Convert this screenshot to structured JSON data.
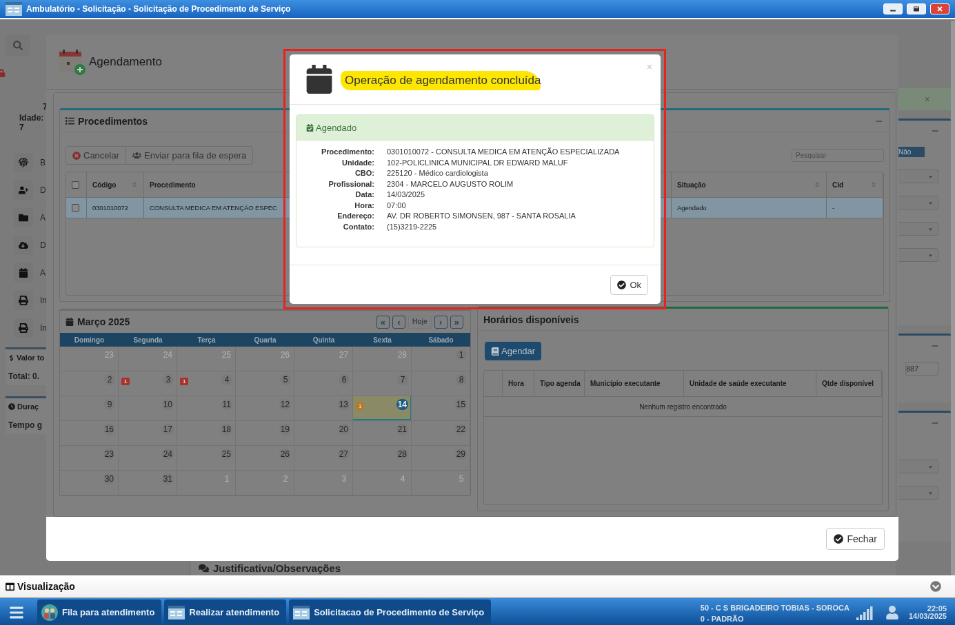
{
  "window": {
    "title": "Ambulatório - Solicitação - Solicitação de Procedimento de Serviço"
  },
  "background": {
    "left": {
      "age_fragment": "7",
      "age_label": "Idade: 7",
      "menu": [
        {
          "kind": "fingerprint",
          "label": "B"
        },
        {
          "kind": "user-plus",
          "label": "D"
        },
        {
          "kind": "folder",
          "label": "A"
        },
        {
          "kind": "download",
          "label": "D"
        },
        {
          "kind": "calendar",
          "label": "A"
        },
        {
          "kind": "print",
          "label": "In"
        },
        {
          "kind": "print",
          "label": "In"
        }
      ],
      "valor": {
        "title": "Valor to",
        "total": "Total: 0."
      },
      "duracao": {
        "title": "Duraç",
        "tempo": "Tempo g"
      }
    },
    "right": {
      "alert_close": "×",
      "toggle": {
        "label": "Não",
        "selected": true
      },
      "field_value": "887"
    },
    "justificativa": "Justificativa/Observações"
  },
  "modal": {
    "title": "Agendamento",
    "procedimentos": {
      "title": "Procedimentos",
      "actions": [
        {
          "kind": "cancel",
          "label": "Cancelar"
        },
        {
          "kind": "queue",
          "label": "Enviar para fila de espera"
        }
      ],
      "search_placeholder": "Pesquisar",
      "select_all_checked": false,
      "columns": [
        {
          "label": "Código",
          "sortable": true
        },
        {
          "label": "Procedimento",
          "sortable": false
        },
        {
          "label": "Situação",
          "sortable": true
        },
        {
          "label": "Cid",
          "sortable": true
        }
      ],
      "rows": [
        {
          "selected": true,
          "checked": false,
          "cells": [
            "0301010072",
            "CONSULTA MEDICA EM ATENÇÃO ESPEC",
            "Agendado",
            "-"
          ]
        }
      ]
    },
    "calendar": {
      "title": "Março 2025",
      "nav": [
        {
          "label": "«",
          "disabled": false
        },
        {
          "label": "‹",
          "disabled": false
        },
        {
          "label": "Hoje",
          "disabled": true
        },
        {
          "label": "›",
          "disabled": false
        },
        {
          "label": "»",
          "disabled": false
        }
      ],
      "weekdays": [
        "Domingo",
        "Segunda",
        "Terça",
        "Quarta",
        "Quinta",
        "Sexta",
        "Sábado"
      ],
      "weeks": [
        [
          {
            "day": "23",
            "other_month": true,
            "today": false
          },
          {
            "day": "24",
            "other_month": true,
            "today": false
          },
          {
            "day": "25",
            "other_month": true,
            "today": false
          },
          {
            "day": "26",
            "other_month": true,
            "today": false
          },
          {
            "day": "27",
            "other_month": true,
            "today": false
          },
          {
            "day": "28",
            "other_month": true,
            "today": false
          },
          {
            "day": "1",
            "other_month": false,
            "today": false
          }
        ],
        [
          {
            "day": "2",
            "other_month": false,
            "today": false
          },
          {
            "day": "3",
            "other_month": false,
            "today": false,
            "badge": {
              "text": "1",
              "color": "#a8322f"
            }
          },
          {
            "day": "4",
            "other_month": false,
            "today": false,
            "badge": {
              "text": "1",
              "color": "#a8322f"
            }
          },
          {
            "day": "5",
            "other_month": false,
            "today": false
          },
          {
            "day": "6",
            "other_month": false,
            "today": false
          },
          {
            "day": "7",
            "other_month": false,
            "today": false
          },
          {
            "day": "8",
            "other_month": false,
            "today": false
          }
        ],
        [
          {
            "day": "9",
            "other_month": false,
            "today": false
          },
          {
            "day": "10",
            "other_month": false,
            "today": false
          },
          {
            "day": "11",
            "other_month": false,
            "today": false
          },
          {
            "day": "12",
            "other_month": false,
            "today": false
          },
          {
            "day": "13",
            "other_month": false,
            "today": false
          },
          {
            "day": "14",
            "other_month": false,
            "today": true,
            "badge": {
              "text": "1",
              "color": "#b57a2c"
            }
          },
          {
            "day": "15",
            "other_month": false,
            "today": false
          }
        ],
        [
          {
            "day": "16",
            "other_month": false,
            "today": false
          },
          {
            "day": "17",
            "other_month": false,
            "today": false
          },
          {
            "day": "18",
            "other_month": false,
            "today": false
          },
          {
            "day": "19",
            "other_month": false,
            "today": false
          },
          {
            "day": "20",
            "other_month": false,
            "today": false
          },
          {
            "day": "21",
            "other_month": false,
            "today": false
          },
          {
            "day": "22",
            "other_month": false,
            "today": false
          }
        ],
        [
          {
            "day": "23",
            "other_month": false,
            "today": false
          },
          {
            "day": "24",
            "other_month": false,
            "today": false
          },
          {
            "day": "25",
            "other_month": false,
            "today": false
          },
          {
            "day": "26",
            "other_month": false,
            "today": false
          },
          {
            "day": "27",
            "other_month": false,
            "today": false
          },
          {
            "day": "28",
            "other_month": false,
            "today": false
          },
          {
            "day": "29",
            "other_month": false,
            "today": false
          }
        ],
        [
          {
            "day": "30",
            "other_month": false,
            "today": false
          },
          {
            "day": "31",
            "other_month": false,
            "today": false
          },
          {
            "day": "1",
            "other_month": true,
            "today": false
          },
          {
            "day": "2",
            "other_month": true,
            "today": false
          },
          {
            "day": "3",
            "other_month": true,
            "today": false
          },
          {
            "day": "4",
            "other_month": true,
            "today": false
          },
          {
            "day": "5",
            "other_month": true,
            "today": false
          }
        ]
      ]
    },
    "horarios": {
      "title": "Horários disponíveis",
      "action": "Agendar",
      "columns": [
        "Hora",
        "Tipo agenda",
        "Município executante",
        "Unidade de saúde executante",
        "Qtde disponível"
      ],
      "empty": "Nenhum registro encontrado"
    },
    "close_button": "Fechar"
  },
  "dialog": {
    "title": "Operação de agendamento concluída",
    "highlighted": true,
    "status": "Agendado",
    "close": "×",
    "details": [
      {
        "label": "Procedimento:",
        "value": "0301010072 - CONSULTA MEDICA EM ATENÇÃO ESPECIALIZADA"
      },
      {
        "label": "Unidade:",
        "value": "102-POLICLINICA MUNICIPAL DR EDWARD MALUF"
      },
      {
        "label": "CBO:",
        "value": "225120 - Médico cardiologista"
      },
      {
        "label": "Profissional:",
        "value": "2304 - MARCELO AUGUSTO ROLIM"
      },
      {
        "label": "Data:",
        "value": "14/03/2025"
      },
      {
        "label": "Hora:",
        "value": "07:00"
      },
      {
        "label": "Endereço:",
        "value": "AV. DR ROBERTO SIMONSEN, 987 - SANTA ROSALIA"
      },
      {
        "label": "Contato:",
        "value": "(15)3219-2225"
      }
    ],
    "ok_button": "Ok"
  },
  "view_bar": {
    "title": "Visualização"
  },
  "taskbar": {
    "tasks": [
      {
        "kind": "people",
        "label": "Fila para atendimento"
      },
      {
        "kind": "window",
        "label": "Realizar atendimento"
      },
      {
        "kind": "window",
        "label": "Solicitacao de Procedimento de Serviço"
      }
    ],
    "unit": "50 - C S BRIGADEIRO TOBIAS - SOROCA",
    "profile": "0 - PADRÃO",
    "time": "22:05",
    "date": "14/03/2025"
  }
}
